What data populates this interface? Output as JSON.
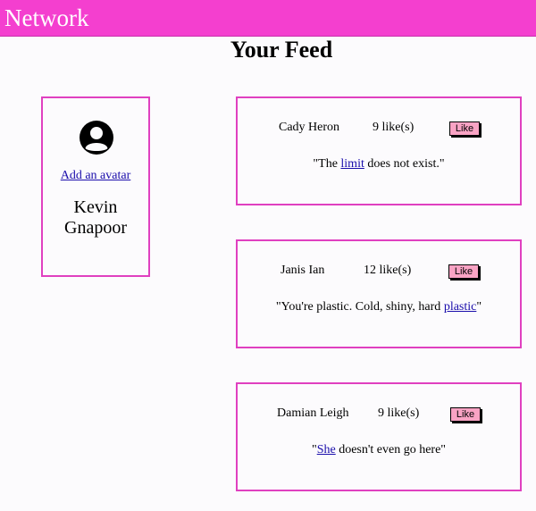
{
  "navbar": {
    "brand": "Network"
  },
  "page": {
    "title": "Your Feed"
  },
  "profile": {
    "avatar_icon": "user-circle-icon",
    "add_avatar_label": "Add an avatar",
    "name": "Kevin Gnapoor"
  },
  "posts": [
    {
      "author": "Cady Heron",
      "likes": "9 like(s)",
      "like_label": "Like",
      "quote_before": "\"The ",
      "quote_link": "limit",
      "quote_after": " does not exist.\""
    },
    {
      "author": "Janis Ian",
      "likes": "12 like(s)",
      "like_label": "Like",
      "quote_before": "\"You're plastic. Cold, shiny, hard ",
      "quote_link": "plastic",
      "quote_after": "\""
    },
    {
      "author": "Damian Leigh",
      "likes": "9 like(s)",
      "like_label": "Like",
      "quote_before": "\"",
      "quote_link": "She",
      "quote_after": " doesn't even go here\""
    }
  ],
  "colors": {
    "navbar": "#f43fcf",
    "card_border": "#e040c0",
    "like_button": "#f9a3c4",
    "link": "#1a0dab"
  }
}
